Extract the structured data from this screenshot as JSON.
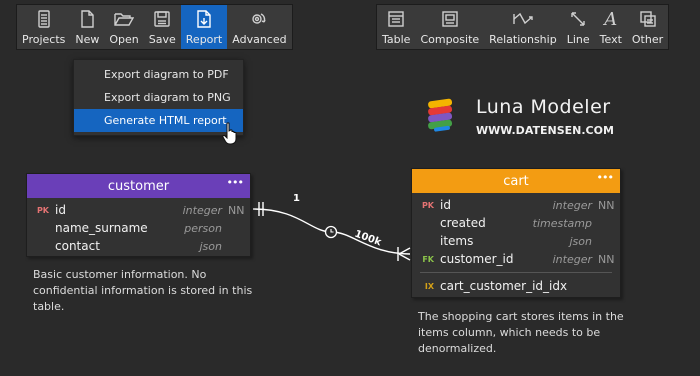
{
  "toolbar_left": [
    {
      "label": "Projects",
      "icon": "projects-icon"
    },
    {
      "label": "New",
      "icon": "new-document-icon"
    },
    {
      "label": "Open",
      "icon": "folder-open-icon"
    },
    {
      "label": "Save",
      "icon": "save-icon"
    },
    {
      "label": "Report",
      "icon": "report-icon"
    },
    {
      "label": "Advanced",
      "icon": "advanced-icon"
    }
  ],
  "toolbar_right": [
    {
      "label": "Table",
      "icon": "table-icon"
    },
    {
      "label": "Composite",
      "icon": "composite-icon"
    },
    {
      "label": "Relationship",
      "icon": "relationship-icon"
    },
    {
      "label": "Line",
      "icon": "line-icon"
    },
    {
      "label": "Text",
      "icon": "text-icon"
    },
    {
      "label": "Other",
      "icon": "other-icon"
    }
  ],
  "report_menu": {
    "items": [
      "Export diagram to PDF",
      "Export diagram to PNG",
      "Generate HTML report"
    ]
  },
  "brand": {
    "title": "Luna Modeler",
    "url": "WWW.DATENSEN.COM"
  },
  "customer": {
    "name": "customer",
    "menu": "•••",
    "columns": [
      {
        "key": "PK",
        "name": "id",
        "type": "integer",
        "nn": "NN"
      },
      {
        "key": "",
        "name": "name_surname",
        "type": "person",
        "nn": ""
      },
      {
        "key": "",
        "name": "contact",
        "type": "json",
        "nn": ""
      }
    ],
    "note": "Basic customer information. No confidential information is stored in this table."
  },
  "cart": {
    "name": "cart",
    "menu": "•••",
    "columns": [
      {
        "key": "PK",
        "name": "id",
        "type": "integer",
        "nn": "NN"
      },
      {
        "key": "",
        "name": "created",
        "type": "timestamp",
        "nn": ""
      },
      {
        "key": "",
        "name": "items",
        "type": "json",
        "nn": ""
      },
      {
        "key": "FK",
        "name": "customer_id",
        "type": "integer",
        "nn": "NN"
      }
    ],
    "index": {
      "key": "IX",
      "name": "cart_customer_id_idx"
    },
    "note": "The shopping cart stores items in the items column, which needs to be denormalized."
  },
  "relationship": {
    "one_label": "1",
    "many_label": "100k"
  },
  "colors": {
    "accent": "#1565c0",
    "customer_header": "#6a3fb8",
    "cart_header": "#f39c12",
    "pk": "#e57373",
    "fk": "#8bc34a",
    "ix": "#d4a017"
  }
}
